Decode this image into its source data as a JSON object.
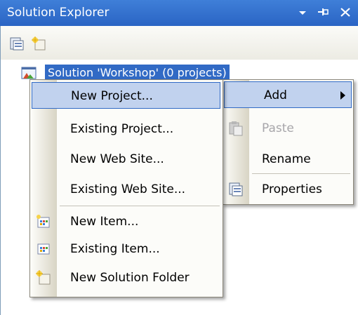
{
  "window": {
    "title": "Solution Explorer",
    "icons": [
      "dropdown-arrow-icon",
      "pin-icon",
      "close-icon"
    ]
  },
  "toolbar": {
    "buttons": [
      "properties-icon",
      "show-all-files-icon"
    ]
  },
  "tree": {
    "solution_label": "Solution 'Workshop' (0 projects)"
  },
  "context_menu": {
    "items": [
      {
        "label": "Add",
        "highlighted": true,
        "has_submenu": true
      },
      {
        "label": "Paste",
        "icon": "paste-icon",
        "disabled": true
      },
      {
        "label": "Rename"
      },
      {
        "label": "Properties",
        "icon": "properties-icon"
      }
    ]
  },
  "add_submenu": {
    "items": [
      {
        "label": "New Project...",
        "highlighted": true
      },
      {
        "label": "Existing Project..."
      },
      {
        "label": "New Web Site..."
      },
      {
        "label": "Existing Web Site..."
      },
      {
        "label": "New Item...",
        "icon": "new-item-icon"
      },
      {
        "label": "Existing Item...",
        "icon": "existing-item-icon"
      },
      {
        "label": "New Solution Folder",
        "icon": "new-folder-icon"
      }
    ]
  },
  "colors": {
    "titlebar": "#2a64c4",
    "selection": "#316ac5",
    "menu_highlight": "#c1d2ee"
  }
}
